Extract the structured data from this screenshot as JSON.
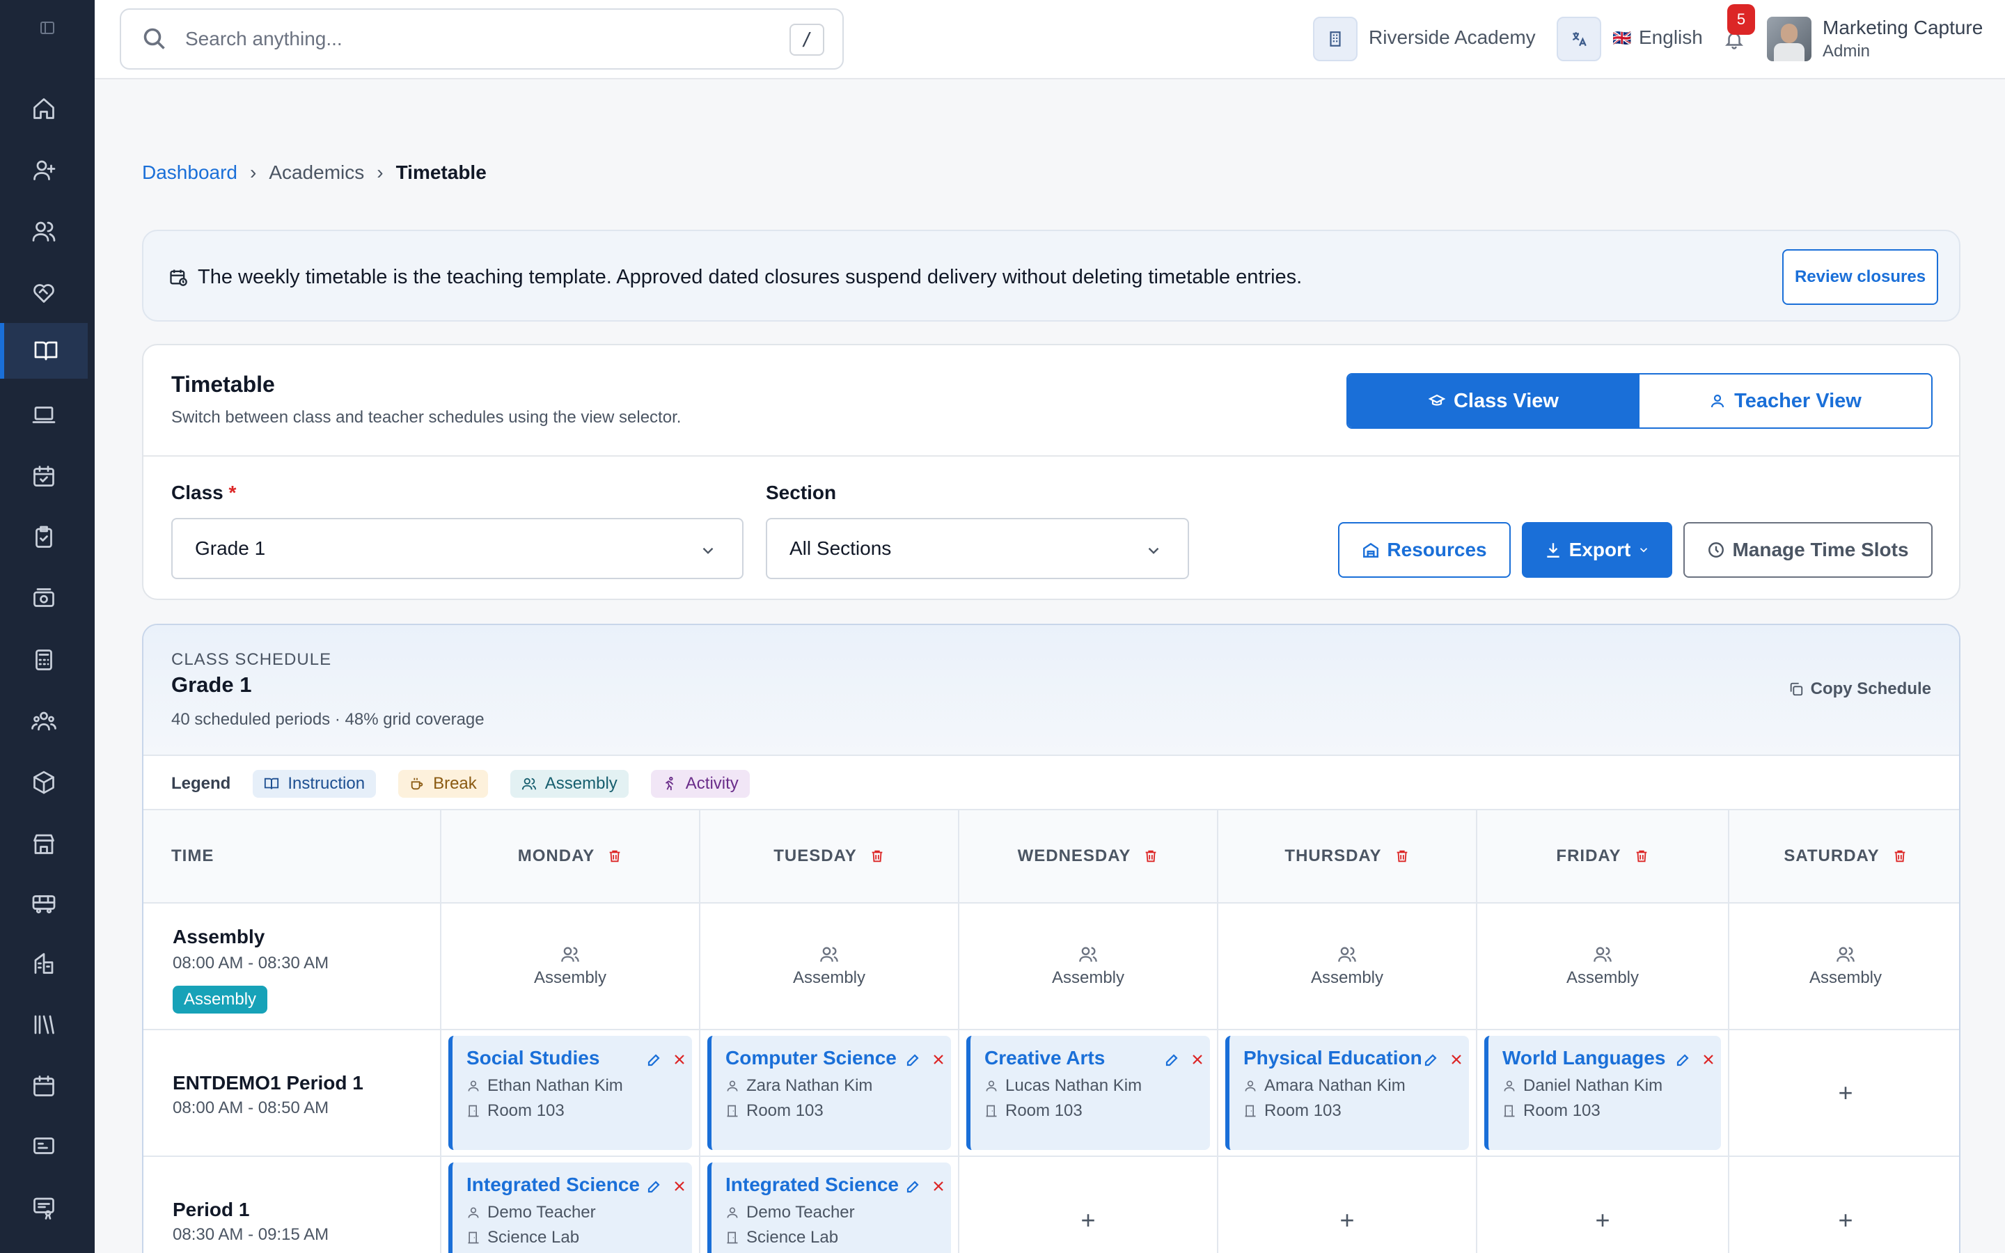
{
  "topbar": {
    "search_placeholder": "Search anything...",
    "search_shortcut": "/",
    "school": "Riverside Academy",
    "language_flag": "🇬🇧",
    "language": "English",
    "notification_count": "5",
    "user_name": "Marketing Capture",
    "user_role": "Admin"
  },
  "sidebar": {
    "items": [
      "home-icon",
      "user-plus-icon",
      "users-icon",
      "heart-handshake-icon",
      "book-open-icon",
      "laptop-icon",
      "calendar-check-icon",
      "clipboard-check-icon",
      "banknote-icon",
      "calculator-icon",
      "people-group-icon",
      "package-icon",
      "store-icon",
      "bus-icon",
      "building-icon",
      "library-icon",
      "calendar-icon",
      "id-card-icon",
      "certificate-icon"
    ],
    "active": "book-open-icon"
  },
  "breadcrumb": {
    "home": "Dashboard",
    "section": "Academics",
    "current": "Timetable",
    "sep": "›"
  },
  "notice": {
    "text": "The weekly timetable is the teaching template. Approved dated closures suspend delivery without deleting timetable entries.",
    "button": "Review closures"
  },
  "timetable": {
    "title": "Timetable",
    "subtitle": "Switch between class and teacher schedules using the view selector.",
    "class_view": "Class View",
    "teacher_view": "Teacher View",
    "class_label": "Class",
    "required_mark": "*",
    "class_value": "Grade 1",
    "section_label": "Section",
    "section_value": "All Sections",
    "resources": "Resources",
    "export": "Export",
    "manage": "Manage Time Slots"
  },
  "schedule": {
    "kicker": "CLASS SCHEDULE",
    "name": "Grade 1",
    "meta": "40 scheduled periods · 48% grid coverage",
    "copy": "Copy Schedule",
    "legend_title": "Legend",
    "legend": {
      "instruction": "Instruction",
      "break": "Break",
      "assembly": "Assembly",
      "activity": "Activity"
    },
    "time_header": "TIME",
    "days": [
      "MONDAY",
      "TUESDAY",
      "WEDNESDAY",
      "THURSDAY",
      "FRIDAY",
      "SATURDAY"
    ],
    "rows": [
      {
        "name": "Assembly",
        "time": "08:00 AM - 08:30 AM",
        "badge": "Assembly",
        "cells": [
          "Assembly",
          "Assembly",
          "Assembly",
          "Assembly",
          "Assembly",
          "Assembly"
        ]
      },
      {
        "name": "ENTDEMO1 Period 1",
        "time": "08:00 AM - 08:50 AM",
        "lessons": [
          {
            "subject": "Social Studies",
            "teacher": "Ethan Nathan Kim",
            "room": "Room 103"
          },
          {
            "subject": "Computer Science",
            "teacher": "Zara Nathan Kim",
            "room": "Room 103"
          },
          {
            "subject": "Creative Arts",
            "teacher": "Lucas Nathan Kim",
            "room": "Room 103"
          },
          {
            "subject": "Physical Education",
            "teacher": "Amara Nathan Kim",
            "room": "Room 103"
          },
          {
            "subject": "World Languages",
            "teacher": "Daniel Nathan Kim",
            "room": "Room 103"
          }
        ],
        "empty_mark": "+"
      },
      {
        "name": "Period 1",
        "time": "08:30 AM - 09:15 AM",
        "lessons": [
          {
            "subject": "Integrated Science",
            "teacher": "Demo Teacher",
            "room": "Science Lab"
          },
          {
            "subject": "Integrated Science",
            "teacher": "Demo Teacher",
            "room": "Science Lab"
          }
        ],
        "empty_mark": "+"
      }
    ]
  },
  "colors": {
    "primary": "#1a6fd8",
    "sidebar": "#1c2638",
    "danger": "#dc2626",
    "assembly_badge": "#17a2b8"
  }
}
